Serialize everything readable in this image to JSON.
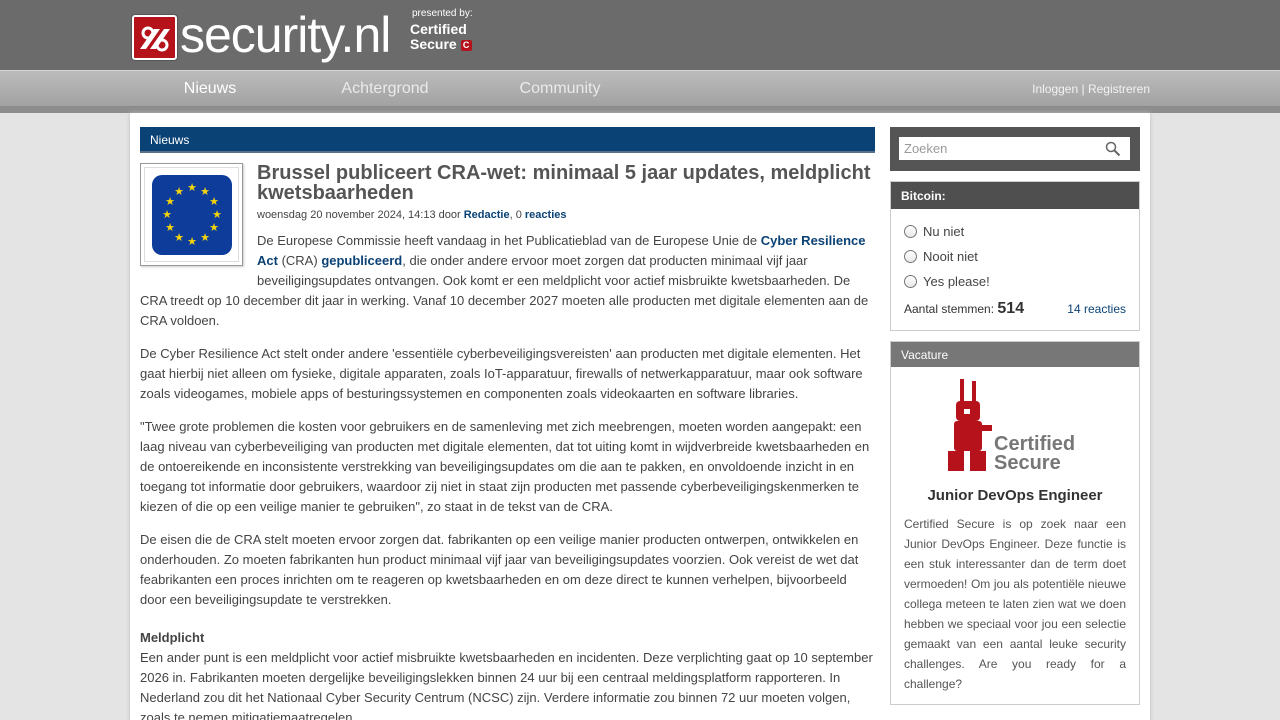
{
  "header": {
    "logo_text": "security.nl",
    "presented_by": "presented by:",
    "partner_line1": "Certified",
    "partner_line2": "Secure"
  },
  "nav": {
    "items": [
      {
        "label": "Nieuws",
        "active": true
      },
      {
        "label": "Achtergrond",
        "active": false
      },
      {
        "label": "Community",
        "active": false
      }
    ],
    "login": "Inloggen",
    "separator": "|",
    "register": "Registreren"
  },
  "section": {
    "title": "Nieuws"
  },
  "article": {
    "title": "Brussel publiceert CRA-wet: minimaal 5 jaar updates, meldplicht kwetsbaarheden",
    "meta_date": "woensdag 20 november 2024, 14:13 door",
    "meta_author": "Redactie",
    "meta_sep": ",",
    "meta_count": "0",
    "meta_reactions": "reacties",
    "intro_a": "De Europese Commissie heeft vandaag in het Publicatieblad van de Europese Unie de",
    "intro_link1": "Cyber Resilience Act",
    "intro_b": "(CRA)",
    "intro_link2": "gepubliceerd",
    "intro_c": ", die onder andere ervoor moet zorgen dat producten minimaal vijf jaar beveiligingsupdates ontvangen. Ook komt er een meldplicht voor actief misbruikte kwetsbaarheden. De CRA treedt op 10 december dit jaar in werking. Vanaf 10 december 2027 moeten alle producten met digitale elementen aan de CRA voldoen.",
    "p2": "De Cyber Resilience Act stelt onder andere 'essentiële cyberbeveiligingsvereisten' aan producten met digitale elementen. Het gaat hierbij niet alleen om fysieke, digitale apparaten, zoals IoT-apparatuur, firewalls of netwerkapparatuur, maar ook software zoals videogames, mobiele apps of besturingssystemen en componenten zoals videokaarten en software libraries.",
    "p3": "\"Twee grote problemen die kosten voor gebruikers en de samenleving met zich meebrengen, moeten worden aangepakt: een laag niveau van cyberbeveiliging van producten met digitale elementen, dat tot uiting komt in wijdverbreide kwetsbaarheden en de ontoereikende en inconsistente verstrekking van beveiligingsupdates om die aan te pakken, en onvoldoende inzicht in en toegang tot informatie door gebruikers, waardoor zij niet in staat zijn producten met passende cyberbeveiligingskenmerken te kiezen of die op een veilige manier te gebruiken\", zo staat in de tekst van de CRA.",
    "p4": "De eisen die de CRA stelt moeten ervoor zorgen dat. fabrikanten op een veilige manier producten ontwerpen, ontwikkelen en onderhouden. Zo moeten fabrikanten hun product minimaal vijf jaar van beveiligingsupdates voorzien. Ook vereist de wet dat feabrikanten een proces inrichten om te reageren op kwetsbaarheden en om deze direct te kunnen verhelpen, bijvoorbeeld door een beveiligingsupdate te verstrekken.",
    "sub1": "Meldplicht",
    "p5": "Een ander punt is een meldplicht voor actief misbruikte kwetsbaarheden en incidenten. Deze verplichting gaat op 10 september 2026 in. Fabrikanten moeten dergelijke beveiligingslekken binnen 24 uur bij een centraal meldingsplatform rapporteren. In Nederland zou dit het Nationaal Cyber Security Centrum (NCSC) zijn. Verdere informatie zou binnen 72 uur moeten volgen, zoals te nemen mitigatiemaatregelen."
  },
  "search": {
    "placeholder": "Zoeken"
  },
  "poll": {
    "title": "Bitcoin:",
    "options": [
      "Nu niet",
      "Nooit niet",
      "Yes please!"
    ],
    "votes_label": "Aantal stemmen:",
    "votes": "514",
    "reactions": "14 reacties"
  },
  "vacature": {
    "heading": "Vacature",
    "logo_line1": "Certified",
    "logo_line2": "Secure",
    "job_title": "Junior DevOps Engineer",
    "text": "Certified Secure is op zoek naar een Junior DevOps Engineer. Deze functie is een stuk interessanter dan de term doet vermoeden! Om jou als potentiële nieuwe collega meteen te laten zien wat we doen hebben we speciaal voor jou een selectie gemaakt van een aantal leuke security challenges. Are you ready for a challenge?"
  },
  "colors": {
    "brand_red": "#b5121b",
    "nav_blue": "#0b4276"
  }
}
